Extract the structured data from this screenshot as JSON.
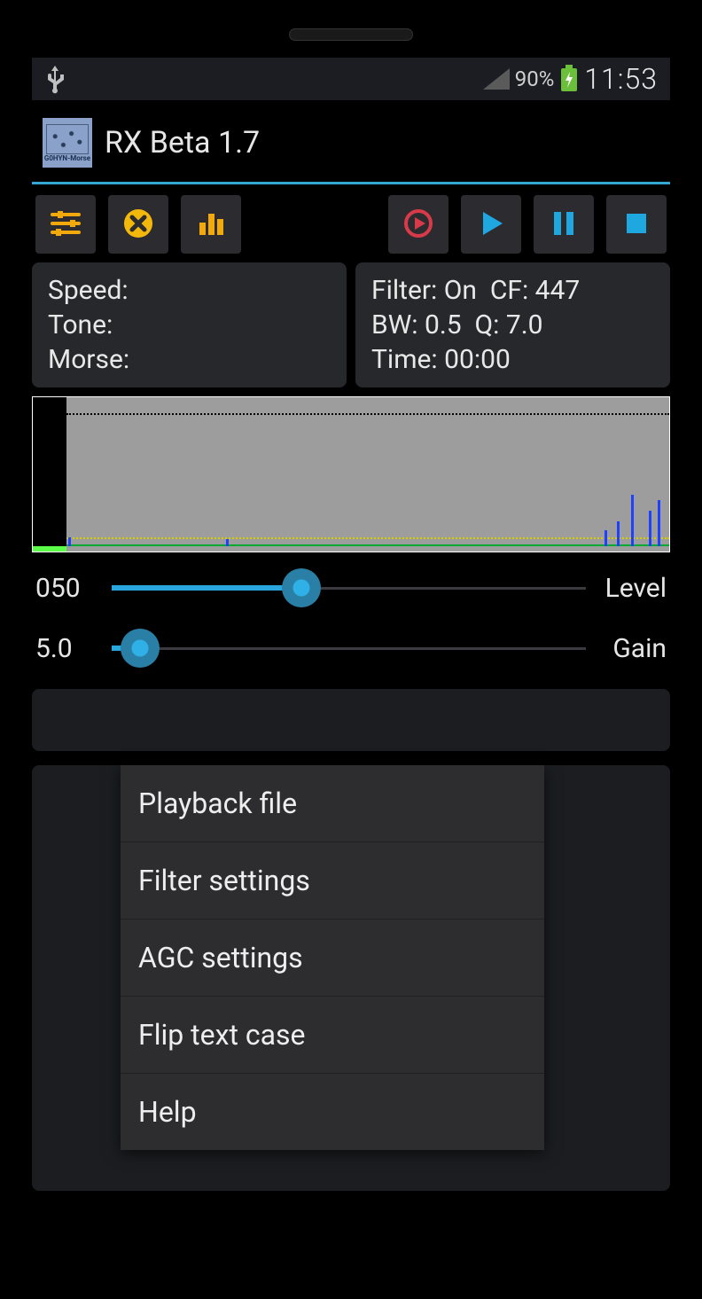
{
  "status": {
    "battery_pct": "90%",
    "time": "11:53"
  },
  "app": {
    "logo_caption": "G0HYN-Morse",
    "title": "RX Beta 1.7"
  },
  "info_left": {
    "speed": "Speed:",
    "tone": "Tone:",
    "morse": "Morse:"
  },
  "info_right": {
    "filter_line": "Filter: On  CF: 447",
    "bw_line": "BW: 0.5  Q: 7.0",
    "time_line": "Time: 00:00"
  },
  "sliders": {
    "level": {
      "value": "050",
      "label": "Level",
      "percent": 40
    },
    "gain": {
      "value": "5.0",
      "label": "Gain",
      "percent": 6
    }
  },
  "menu": {
    "items": [
      "Playback file",
      "Filter settings",
      "AGC settings",
      "Flip text case",
      "Help"
    ]
  },
  "icons": {
    "usb": "usb",
    "signal": "signal",
    "battery": "battery-charging",
    "sliders": "settings-sliders",
    "close": "close-circle",
    "bars": "bar-chart",
    "record": "record",
    "play": "play",
    "pause": "pause",
    "stop": "stop"
  }
}
